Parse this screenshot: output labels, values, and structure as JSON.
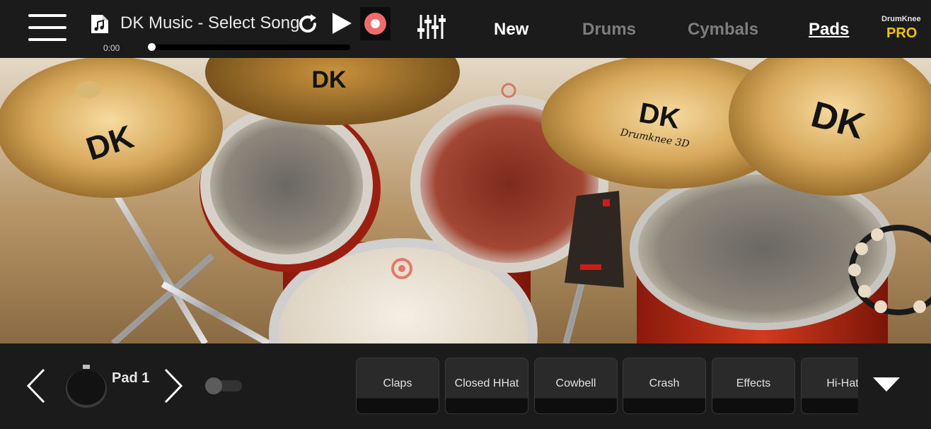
{
  "topbar": {
    "menu_icon": "hamburger-menu-icon",
    "song_icon": "music-file-icon",
    "song_title": "DK Music - Select Song",
    "time": "0:00",
    "progress": 0,
    "repeat_icon": "repeat-icon",
    "play_icon": "play-icon",
    "record_icon": "record-icon",
    "record_color": "#f26b6b",
    "mixer_icon": "mixer-sliders-icon",
    "tabs": [
      {
        "label": "New"
      },
      {
        "label": "Drums"
      },
      {
        "label": "Cymbals"
      },
      {
        "label": "Pads"
      }
    ],
    "brand_small": "DrumKnee",
    "brand_pro": "PRO",
    "pro_color": "#f2c200"
  },
  "scene": {
    "cymbal_labels": [
      "DK",
      "DK",
      "DK",
      "DK"
    ],
    "cymbal_sublabel": "Drumknee 3D"
  },
  "bottombar": {
    "prev_icon": "chevron-left-icon",
    "next_icon": "chevron-right-icon",
    "pad_label": "Pad 1",
    "toggle_on": false,
    "pads": [
      {
        "label": "Claps"
      },
      {
        "label": "Closed HHat"
      },
      {
        "label": "Cowbell"
      },
      {
        "label": "Crash"
      },
      {
        "label": "Effects"
      },
      {
        "label": "Hi-Hat"
      }
    ],
    "collapse_icon": "triangle-down-icon"
  }
}
